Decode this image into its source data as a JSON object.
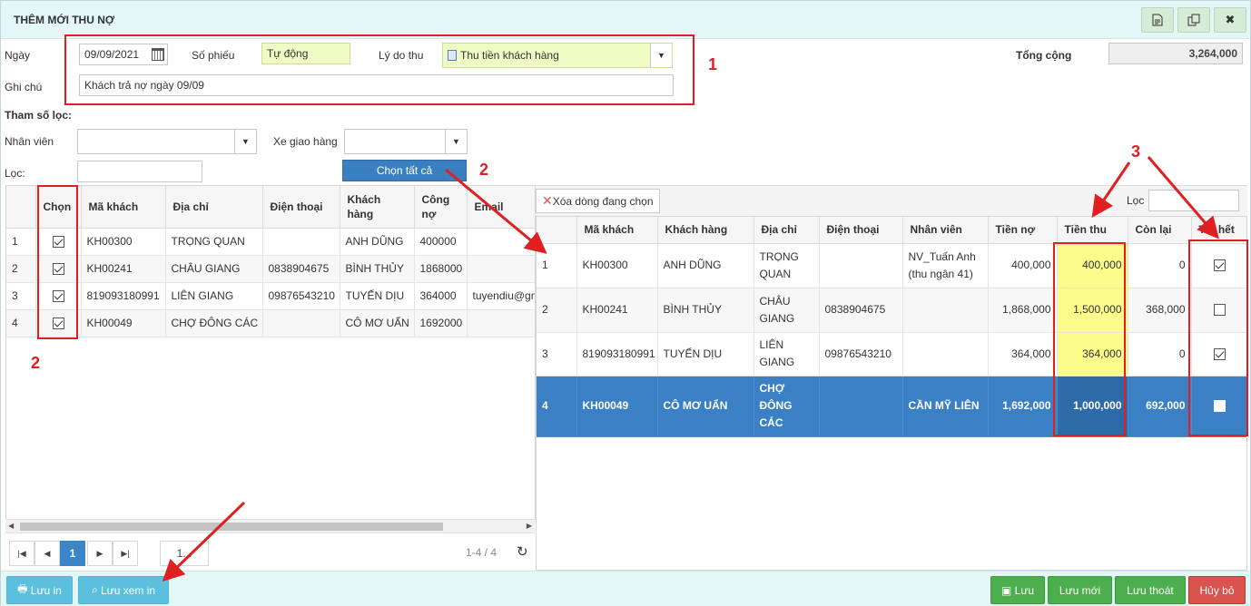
{
  "window": {
    "title": "THÊM MỚI THU NỢ",
    "header_icons": [
      "document-icon",
      "copy-icon",
      "close-icon"
    ],
    "close_glyph": "✖"
  },
  "form": {
    "date_label": "Ngày",
    "date_value": "09/09/2021",
    "voucher_label": "Số phiếu",
    "voucher_value": "Tự động",
    "reason_label": "Lý do thu",
    "reason_value": "Thu tiền khách hàng",
    "note_label": "Ghi chú",
    "note_value": "Khách trả nợ ngày 09/09",
    "total_label": "Tổng cộng",
    "total_value": "3,264,000"
  },
  "filter": {
    "title": "Tham số lọc:",
    "staff_label": "Nhân viên",
    "staff_value": "",
    "vehicle_label": "Xe giao hàng",
    "vehicle_value": "",
    "search_label": "Lọc:",
    "search_value": "",
    "select_all_label": "Chọn tất cả"
  },
  "left_table": {
    "columns": [
      "",
      "Chọn",
      "Mã khách",
      "Địa chỉ",
      "Điện thoại",
      "Khách hàng",
      "Công nợ",
      "Email"
    ],
    "rows": [
      {
        "no": "1",
        "checked": true,
        "code": "KH00300",
        "address": "TRỌNG QUAN",
        "phone": "",
        "customer": "ANH DŨNG",
        "debt": "400000",
        "email": ""
      },
      {
        "no": "2",
        "checked": true,
        "code": "KH00241",
        "address": "CHÂU GIANG",
        "phone": "0838904675",
        "customer": "BÌNH THỦY",
        "debt": "1868000",
        "email": ""
      },
      {
        "no": "3",
        "checked": true,
        "code": "819093180991",
        "address": "LIÊN GIANG",
        "phone": "09876543210",
        "customer": "TUYẾN DỊU",
        "debt": "364000",
        "email": "tuyendiu@gm"
      },
      {
        "no": "4",
        "checked": true,
        "code": "KH00049",
        "address": "CHỢ ĐÔNG CÁC",
        "phone": "",
        "customer": "CÔ MƠ UẨN",
        "debt": "1692000",
        "email": ""
      }
    ]
  },
  "pager": {
    "current_page": "1",
    "page_size": "1...",
    "range": "1-4 / 4"
  },
  "right_panel": {
    "delete_label": "Xóa dòng đang chọn",
    "search_label": "Lọc",
    "search_value": ""
  },
  "right_table": {
    "columns": [
      "",
      "Mã khách",
      "Khách hàng",
      "Địa chỉ",
      "Điện thoại",
      "Nhân viên",
      "Tiền nợ",
      "Tiền thu",
      "Còn lại",
      "Trả hết"
    ],
    "rows": [
      {
        "no": "1",
        "code": "KH00300",
        "customer": "ANH DŨNG",
        "address": "TRỌNG QUAN",
        "phone": "",
        "staff": "NV_Tuấn Anh (thu ngân 41)",
        "debt": "400,000",
        "paid": "400,000",
        "remain": "0",
        "paid_full": true
      },
      {
        "no": "2",
        "code": "KH00241",
        "customer": "BÌNH THỦY",
        "address": "CHÂU GIANG",
        "phone": "0838904675",
        "staff": "",
        "debt": "1,868,000",
        "paid": "1,500,000",
        "remain": "368,000",
        "paid_full": false
      },
      {
        "no": "3",
        "code": "819093180991",
        "customer": "TUYẾN DỊU",
        "address": "LIÊN GIANG",
        "phone": "09876543210",
        "staff": "",
        "debt": "364,000",
        "paid": "364,000",
        "remain": "0",
        "paid_full": true
      },
      {
        "no": "4",
        "code": "KH00049",
        "customer": "CÔ MƠ UẨN",
        "address": "CHỢ ĐÔNG CÁC",
        "phone": "",
        "staff": "CẦN MỸ LIÊN",
        "debt": "1,692,000",
        "paid": "1,000,000",
        "remain": "692,000",
        "paid_full": false
      }
    ]
  },
  "footer": {
    "save_print_label": "Lưu in",
    "save_preview_label": "Lưu xem in",
    "save_label": "Lưu",
    "save_new_label": "Lưu mới",
    "save_exit_label": "Lưu thoát",
    "cancel_label": "Hủy bỏ"
  },
  "annotations": {
    "n1": "1",
    "n2a": "2",
    "n2b": "2",
    "n3": "3",
    "color": "#e02020"
  }
}
